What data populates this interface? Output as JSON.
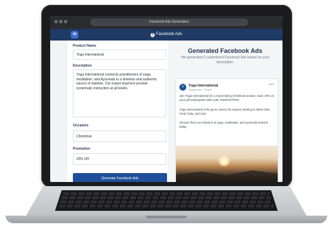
{
  "browser": {
    "tab_title": "Facebook Ads Generation"
  },
  "app": {
    "logo_text": "AI",
    "header_title": "Facebook Ads",
    "fb_glyph": "f"
  },
  "form": {
    "product_name_label": "Product Name",
    "product_name_value": "Yoga International",
    "description_label": "Description",
    "description_value": "Yoga International connects practitioners of yoga, meditation, and Ayurveda to a timeless and authentic source of wisdom. Our expert teachers provide systematic instruction at all levels.",
    "occasion_label": "Occasion",
    "occasion_value": "Christmas",
    "promotion_label": "Promotion",
    "promotion_value": "20% Off",
    "generate_button": "Generate Facebook Ads"
  },
  "results": {
    "title": "Generated Facebook Ads",
    "subtitle": "We generated 3 customized Facebook Ads based on your description.",
    "ad": {
      "avatar_text": "Y",
      "page_name": "Yoga International",
      "meta": "Sponsored · Public",
      "more": "•••",
      "paragraph_1": "Join Yoga International for a rejuvenating Christmas season. Save 20% on your gift subscription with code YINNOVATION.",
      "paragraph_2": "Yoga International is the go-to source for anyone wanting to better their mind, body, and soul.",
      "paragraph_3": "Choose from our selection of yoga, meditation, and Ayurveda lessons today."
    }
  }
}
